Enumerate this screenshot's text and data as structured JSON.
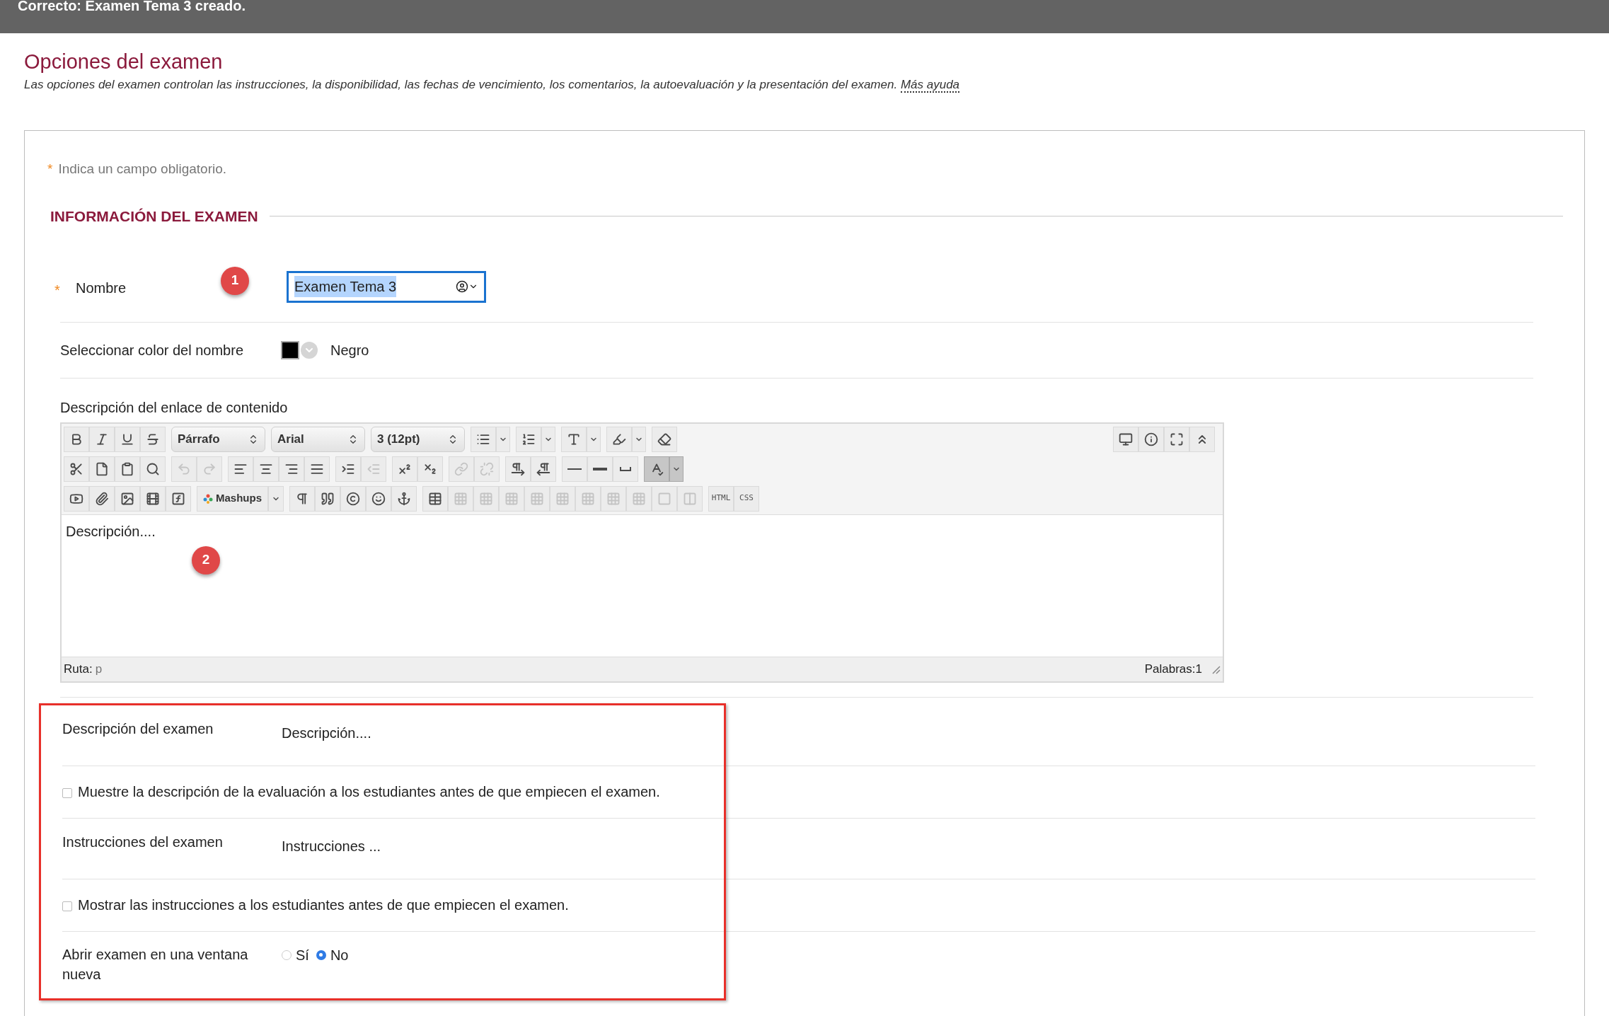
{
  "banner": {
    "message": "Correcto: Examen Tema 3 creado."
  },
  "page": {
    "title": "Opciones del examen",
    "description": "Las opciones del examen controlan las instrucciones, la disponibilidad, las fechas de vencimiento, los comentarios, la autoevaluación y la presentación del examen.",
    "help_link": "Más ayuda"
  },
  "required_note": {
    "mark": "*",
    "text": "Indica un campo obligatorio."
  },
  "section": {
    "title": "INFORMACIÓN DEL EXAMEN"
  },
  "name_field": {
    "required_mark": "*",
    "label": "Nombre",
    "value": "Examen Tema 3",
    "focused": true,
    "text_selected": true,
    "annotation": "1"
  },
  "name_color": {
    "label": "Seleccionar color del nombre",
    "color": "#000000",
    "value": "Negro"
  },
  "editor": {
    "label": "Descripción del enlace de contenido",
    "content": "Descripción....",
    "annotation": "2",
    "path_label": "Ruta:",
    "path_value": "p",
    "word_count": "Palabras:1",
    "toolbar_rows": [
      [
        [
          {
            "kind": "bold"
          },
          {
            "kind": "italic"
          },
          {
            "kind": "underline"
          },
          {
            "kind": "strikethrough"
          }
        ],
        [
          {
            "kind": "select",
            "value": "Párrafo"
          }
        ],
        [
          {
            "kind": "select",
            "value": "Arial"
          }
        ],
        [
          {
            "kind": "select",
            "value": "3 (12pt)"
          }
        ],
        [
          {
            "kind": "bullet-list",
            "split": true
          }
        ],
        [
          {
            "kind": "numbered-list",
            "split": true
          }
        ],
        [
          {
            "kind": "text-color",
            "split": true
          }
        ],
        [
          {
            "kind": "highlighter",
            "split": true
          }
        ],
        [
          {
            "kind": "eraser"
          }
        ]
      ],
      [
        [
          {
            "kind": "cut"
          },
          {
            "kind": "copy"
          },
          {
            "kind": "paste"
          },
          {
            "kind": "find"
          }
        ],
        [
          {
            "kind": "undo",
            "disabled": true
          },
          {
            "kind": "redo",
            "disabled": true
          }
        ],
        [
          {
            "kind": "align-left"
          },
          {
            "kind": "align-center"
          },
          {
            "kind": "align-right"
          },
          {
            "kind": "align-justify"
          }
        ],
        [
          {
            "kind": "indent"
          },
          {
            "kind": "outdent",
            "disabled": true
          }
        ],
        [
          {
            "kind": "superscript"
          },
          {
            "kind": "subscript"
          }
        ],
        [
          {
            "kind": "link",
            "disabled": true
          },
          {
            "kind": "unlink",
            "disabled": true
          }
        ],
        [
          {
            "kind": "ltr"
          },
          {
            "kind": "rtl"
          }
        ],
        [
          {
            "kind": "rule"
          },
          {
            "kind": "thick-rule"
          },
          {
            "kind": "space"
          }
        ],
        [
          {
            "kind": "spellcheck",
            "split": true,
            "pressed": true
          }
        ]
      ],
      [
        [
          {
            "kind": "video"
          },
          {
            "kind": "attach"
          },
          {
            "kind": "image"
          },
          {
            "kind": "media"
          },
          {
            "kind": "formula"
          }
        ],
        [
          {
            "kind": "mashups",
            "label": "Mashups",
            "split": true
          }
        ],
        [
          {
            "kind": "pilcrow"
          },
          {
            "kind": "quote"
          },
          {
            "kind": "copyright"
          },
          {
            "kind": "emoji"
          },
          {
            "kind": "anchor"
          }
        ],
        [
          {
            "kind": "table"
          },
          {
            "kind": "table-op",
            "disabled": true
          },
          {
            "kind": "table-op",
            "disabled": true
          },
          {
            "kind": "table-op",
            "disabled": true
          },
          {
            "kind": "table-op",
            "disabled": true
          },
          {
            "kind": "table-op",
            "disabled": true
          },
          {
            "kind": "table-op",
            "disabled": true
          },
          {
            "kind": "table-op",
            "disabled": true
          },
          {
            "kind": "table-op",
            "disabled": true
          },
          {
            "kind": "cell",
            "disabled": true
          },
          {
            "kind": "columns",
            "disabled": true
          }
        ],
        [
          {
            "kind": "text",
            "label": "HTML"
          },
          {
            "kind": "text",
            "label": "CSS"
          }
        ]
      ]
    ],
    "toolbar_right": [
      {
        "kind": "preview"
      },
      {
        "kind": "info"
      },
      {
        "kind": "fullscreen"
      },
      {
        "kind": "collapse"
      }
    ]
  },
  "highlighted_fields": [
    {
      "kind": "text",
      "label": "Descripción del examen",
      "value": "Descripción...."
    },
    {
      "kind": "checkbox",
      "label": "Muestre la descripción de la evaluación a los estudiantes antes de que empiecen el examen.",
      "checked": false
    },
    {
      "kind": "text",
      "label": "Instrucciones del examen",
      "value": "Instrucciones ..."
    },
    {
      "kind": "checkbox",
      "label": "Mostrar las instrucciones a los estudiantes antes de que empiecen el examen.",
      "checked": false
    },
    {
      "kind": "radio",
      "label": "Abrir examen en una ventana nueva",
      "options": [
        {
          "label": "Sí",
          "selected": false
        },
        {
          "label": "No",
          "selected": true
        }
      ]
    }
  ]
}
